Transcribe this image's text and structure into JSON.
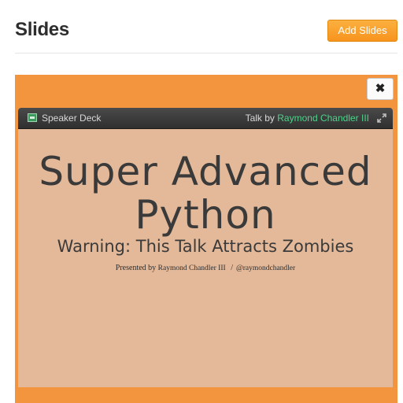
{
  "header": {
    "title": "Slides",
    "add_button": "Add Slides"
  },
  "panel": {
    "close_symbol": "✖",
    "accent": "#f3943f"
  },
  "embed": {
    "brand_icon": "speaker-deck-logo-icon",
    "brand": "Speaker Deck",
    "talk_by_prefix": "Talk by",
    "author": "Raymond Chandler III",
    "expand_icon": "expand-icon"
  },
  "slide": {
    "title_line1": "Super Advanced",
    "title_line2": "Python",
    "subtitle": "Warning: This Talk Attracts Zombies",
    "presented_by_label": "Presented by",
    "presenter": "Raymond Chandler III",
    "separator": "/",
    "handle": "@raymondchandler"
  }
}
